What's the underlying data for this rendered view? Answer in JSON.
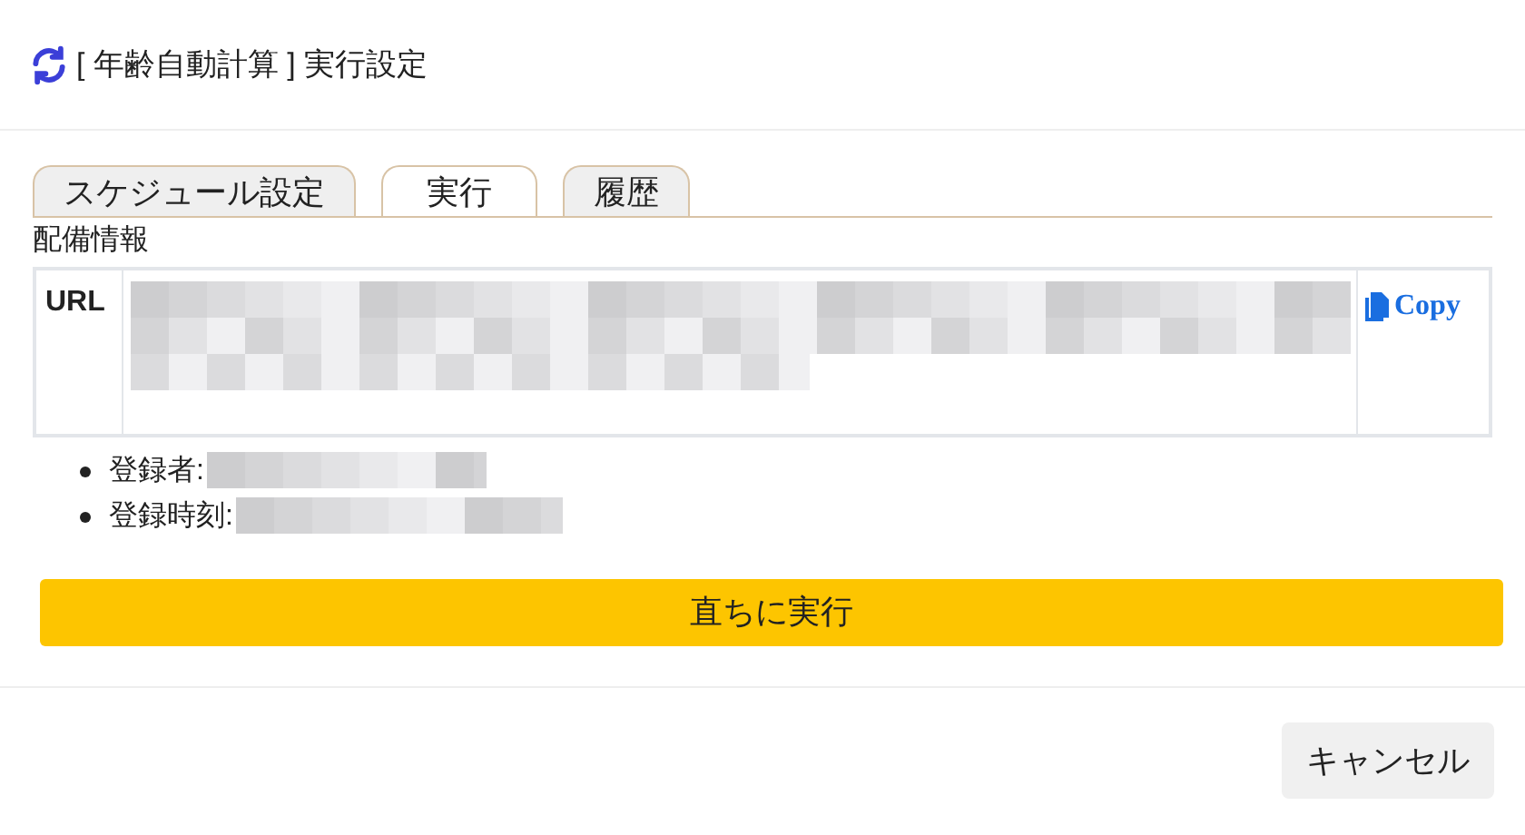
{
  "dialog": {
    "title": "[ 年齢自動計算 ] 実行設定"
  },
  "tabs": [
    {
      "label": "スケジュール設定",
      "selected": false
    },
    {
      "label": "実行",
      "selected": true
    },
    {
      "label": "履歴",
      "selected": false
    }
  ],
  "section_title": "配備情報",
  "url_row": {
    "label": "URL",
    "copy_button": "Copy"
  },
  "details": [
    {
      "label": "登録者:"
    },
    {
      "label": "登録時刻:"
    }
  ],
  "run_button": "直ちに実行",
  "cancel_button": "キャンセル"
}
